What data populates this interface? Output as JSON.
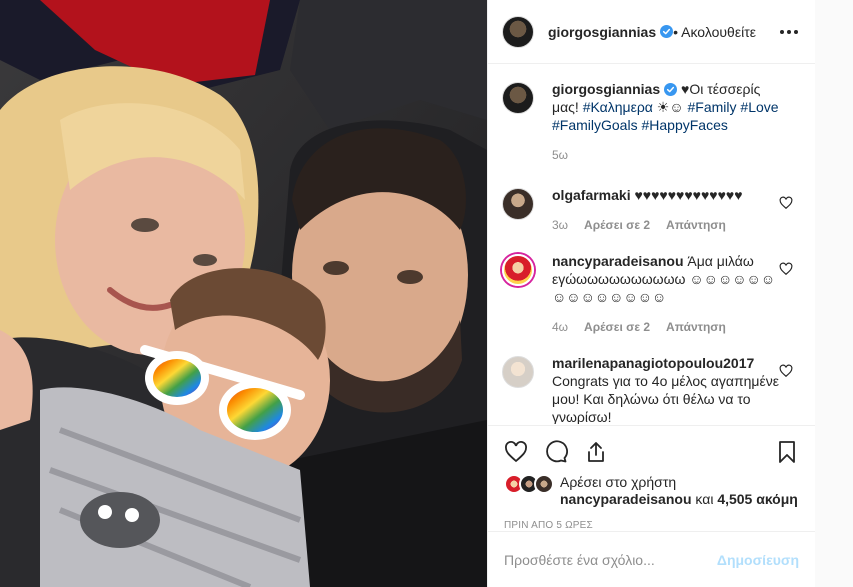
{
  "header": {
    "username": "giorgosgiannias",
    "follow_label": "• Ακολουθείτε"
  },
  "caption": {
    "username": "giorgosgiannias",
    "text_prefix": " ♥Οι τέσσερίς μας! ",
    "tag_kalimera": "#Καλημερα",
    "emojis": " ☀☺ ",
    "tag_family": "#Family",
    "tag_love": "#Love",
    "tag_goals": "#FamilyGoals",
    "tag_happy": "#HappyFaces",
    "age": "5ω"
  },
  "comments": [
    {
      "username": "olgafarmaki",
      "text": " ♥♥♥♥♥♥♥♥♥♥♥♥♥",
      "age": "3ω",
      "likes": "Αρέσει σε 2",
      "reply": "Απάντηση"
    },
    {
      "username": "nancyparadeisanou",
      "text": " Άμα μιλάω εγώωωωωωωωωωω ☺☺☺☺☺☺☺☺☺☺☺☺☺☺",
      "age": "4ω",
      "likes": "Αρέσει σε 2",
      "reply": "Απάντηση"
    },
    {
      "username": "marilenapanagiotopoulou2017",
      "text": " Congrats για το 4ο μέλος αγαπημένε μου! Και δηλώνω ότι θέλω να το γνωρίσω!",
      "age": "",
      "likes": "",
      "reply": ""
    }
  ],
  "likes": {
    "prefix": "Αρέσει στο χρήστη",
    "user": "nancyparadeisanou",
    "and": " και ",
    "count": "4,505 ακόμη"
  },
  "timestamp": "ΠΡΙΝ ΑΠΟ 5 ΩΡΕΣ",
  "add_comment": {
    "placeholder": "Προσθέστε ένα σχόλιο...",
    "post_label": "Δημοσίευση"
  },
  "icons": {
    "heart": "heart-icon",
    "comment": "comment-icon",
    "share": "share-icon",
    "bookmark": "bookmark-icon",
    "verified": "verified-badge-icon",
    "more": "more-options-icon"
  },
  "colors": {
    "link": "#003569",
    "muted": "#8e8e8e",
    "post_button": "#b2dffc",
    "verified": "#3897f0"
  }
}
